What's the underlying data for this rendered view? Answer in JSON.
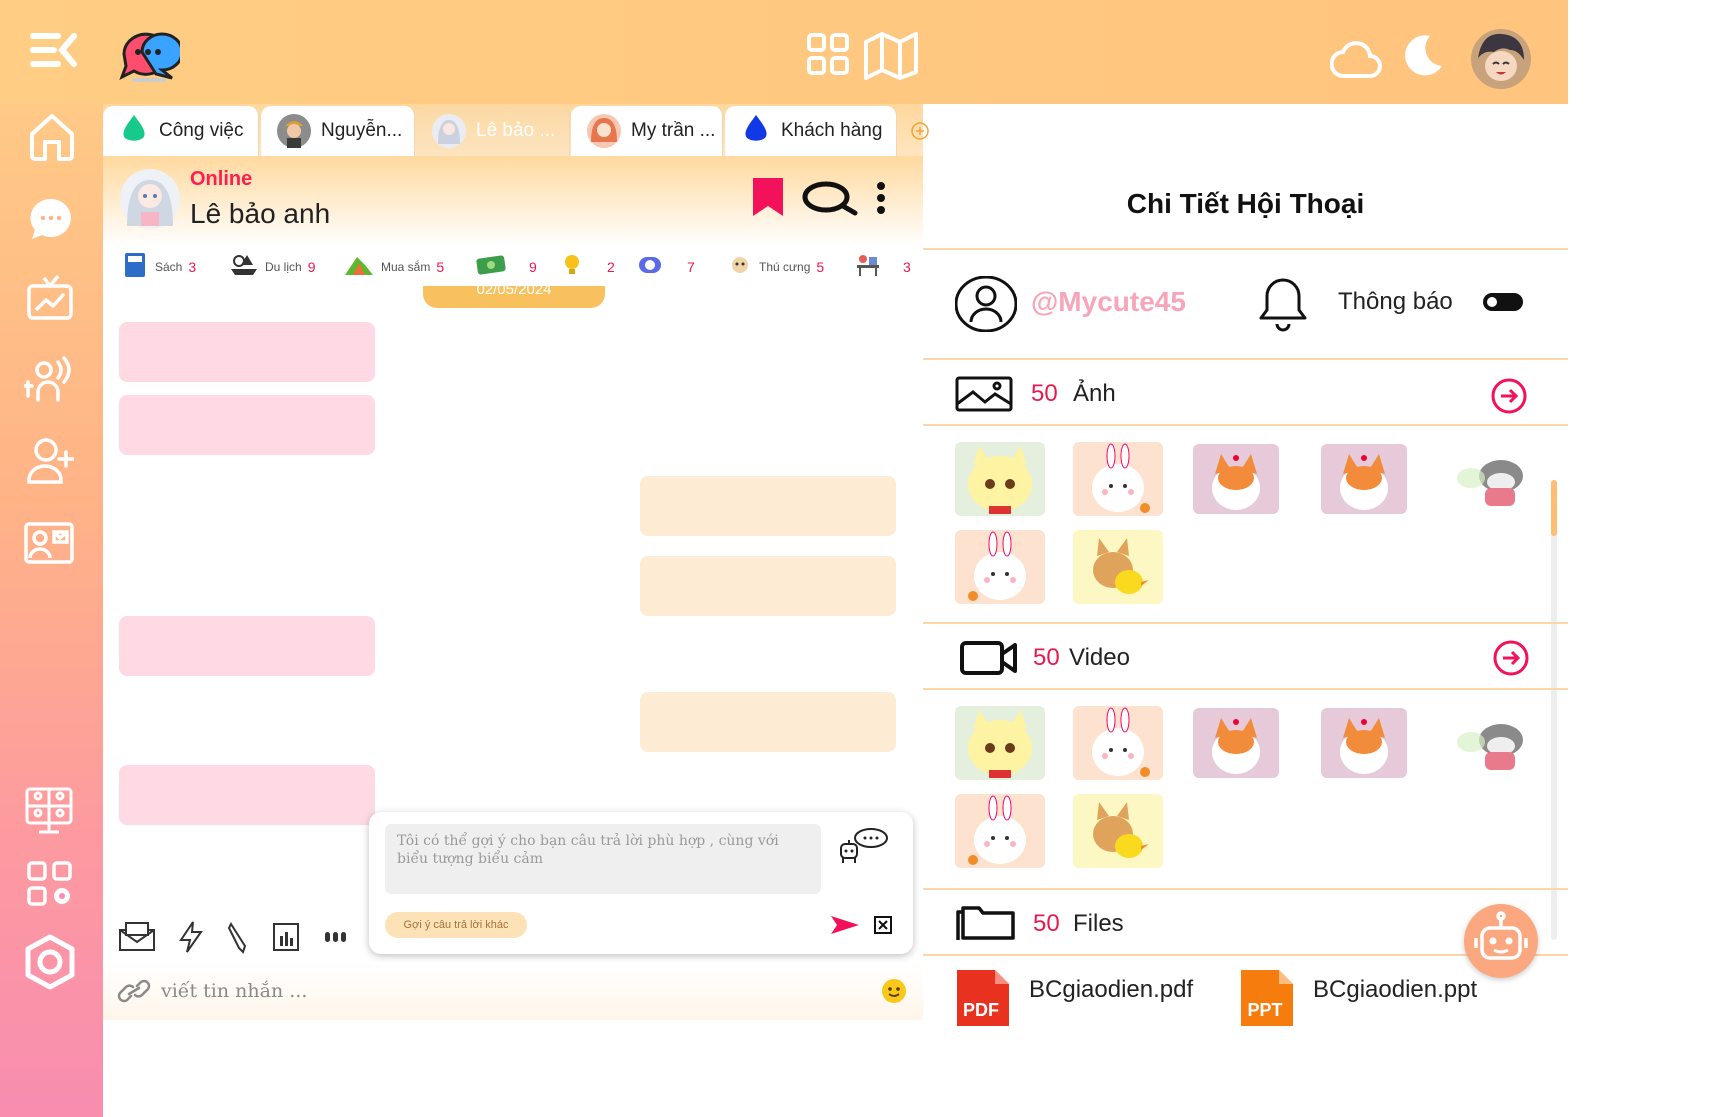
{
  "tabs": [
    {
      "label": "Công việc",
      "icon": "green-drop-icon",
      "active": false
    },
    {
      "label": "Nguyễn...",
      "icon": "avatar",
      "active": false
    },
    {
      "label": "Lê bảo ...",
      "icon": "avatar",
      "active": true
    },
    {
      "label": "My trần ...",
      "icon": "avatar",
      "active": false
    },
    {
      "label": "Khách hàng",
      "icon": "blue-drop-icon",
      "active": false
    }
  ],
  "chat": {
    "status": "Online",
    "name": "Lê bảo anh",
    "date": "02/05/2024",
    "categories": [
      {
        "label": "Sách",
        "count": "3"
      },
      {
        "label": "Du lịch",
        "count": "9"
      },
      {
        "label": "Mua sắm",
        "count": "5"
      },
      {
        "label": "",
        "count": "9"
      },
      {
        "label": "",
        "count": "2"
      },
      {
        "label": "",
        "count": "7"
      },
      {
        "label": "Thú cưng",
        "count": "5"
      },
      {
        "label": "",
        "count": "3"
      }
    ],
    "suggestion_text": "Tôi có thể gợi ý cho bạn câu trả lời phù hợp , cùng với biểu tượng biểu cảm",
    "suggestion_button": "Gợi ý câu trả lời khác",
    "composer_placeholder": "viết tin nhắn ..."
  },
  "details": {
    "title": "Chi Tiết Hội Thoại",
    "handle": "@Mycute45",
    "notify_label": "Thông báo",
    "images": {
      "count": "50",
      "label": "Ảnh"
    },
    "videos": {
      "count": "50",
      "label": "Video"
    },
    "files": {
      "count": "50",
      "label": "Files"
    },
    "file_list": [
      "BCgiaodien.pdf",
      "BCgiaodien.ppt"
    ],
    "file_badges": [
      "PDF",
      "PPT"
    ]
  },
  "colors": {
    "accent": "#e8194f",
    "orange": "#ffc47e",
    "pink_bubble": "#ffd9e4",
    "cream_bubble": "#fdebd3"
  }
}
